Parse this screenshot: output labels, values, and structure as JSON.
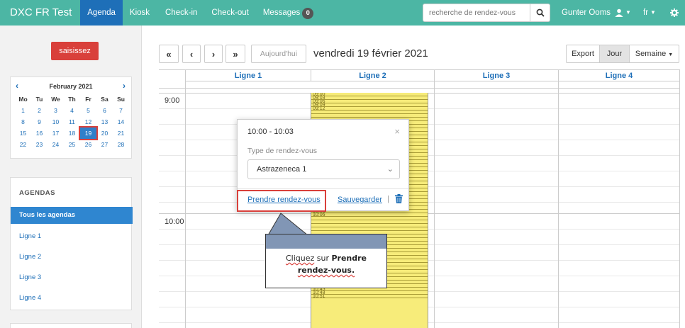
{
  "navbar": {
    "brand": "DXC FR Test",
    "items": [
      {
        "label": "Agenda",
        "active": true
      },
      {
        "label": "Kiosk",
        "active": false
      },
      {
        "label": "Check-in",
        "active": false
      },
      {
        "label": "Check-out",
        "active": false
      },
      {
        "label": "Messages",
        "active": false
      }
    ],
    "messages_count": "0",
    "search_placeholder": "recherche de rendez-vous",
    "user": "Gunter Ooms",
    "language": "fr"
  },
  "sidebar": {
    "action_button": "saisissez",
    "calendar": {
      "month": "February 2021",
      "prev": "‹",
      "next": "›",
      "dows": [
        "Mo",
        "Tu",
        "We",
        "Th",
        "Fr",
        "Sa",
        "Su"
      ],
      "weeks": [
        [
          "1",
          "2",
          "3",
          "4",
          "5",
          "6",
          "7"
        ],
        [
          "8",
          "9",
          "10",
          "11",
          "12",
          "13",
          "14"
        ],
        [
          "15",
          "16",
          "17",
          "18",
          "19",
          "20",
          "21"
        ],
        [
          "22",
          "23",
          "24",
          "25",
          "26",
          "27",
          "28"
        ]
      ],
      "selected": "19"
    },
    "agendas_title": "AGENDAS",
    "agendas": [
      "Tous les agendas",
      "Ligne 1",
      "Ligne 2",
      "Ligne 3",
      "Ligne 4"
    ],
    "active_agenda": "Tous les agendas"
  },
  "toolbar": {
    "first": "«",
    "prev": "‹",
    "next": "›",
    "last": "»",
    "today": "Aujourd'hui",
    "date_title": "vendredi 19 février 2021",
    "export": "Export",
    "day": "Jour",
    "week": "Semaine"
  },
  "grid": {
    "columns": [
      "Ligne 1",
      "Ligne 2",
      "Ligne 3",
      "Ligne 4"
    ],
    "times": [
      "9:00",
      "10:00"
    ],
    "slots_visible": [
      "09:00",
      "09:03",
      "09:06",
      "09:09",
      "09:12",
      "10:00",
      "10:03",
      "10:06",
      "10:36",
      "10:39",
      "10:42",
      "10:45",
      "10:48",
      "10:51"
    ]
  },
  "popover": {
    "time_range": "10:00 - 10:03",
    "type_label": "Type de rendez-vous",
    "type_value": "Astrazeneca 1",
    "book_link": "Prendre rendez-vous",
    "save_link": "Sauvegarder",
    "separator": "|"
  },
  "callout": {
    "text_prefix": "Cliquez",
    "text_middle": " sur ",
    "text_bold_1": "Prendre",
    "text_bold_2": "rendez-vous."
  },
  "colors": {
    "navbar": "#4cb6a4",
    "nav_active": "#1e6fb8",
    "danger": "#d9403b",
    "slot_yellow": "#f7ec7a",
    "callout_bar": "#8196b5"
  }
}
